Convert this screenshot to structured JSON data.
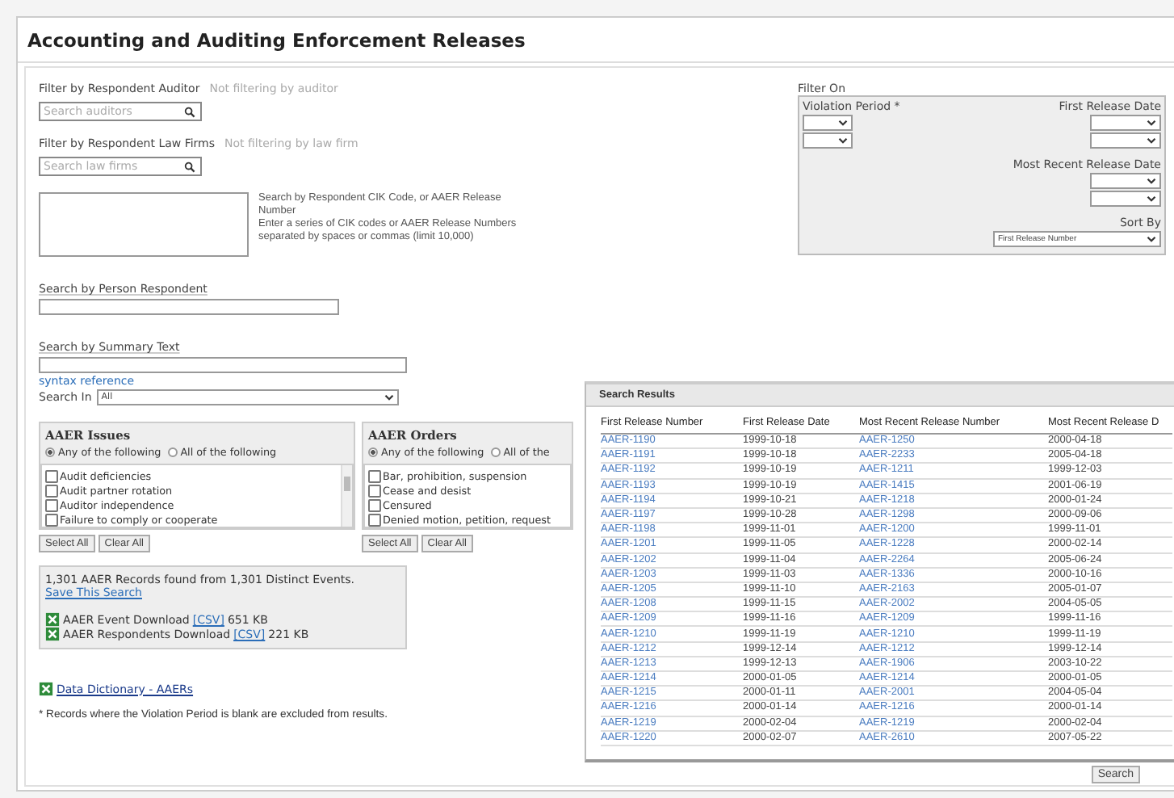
{
  "title": "Accounting and Auditing Enforcement Releases",
  "auditor_filter": {
    "label": "Filter by Respondent Auditor",
    "status": "Not filtering by auditor",
    "placeholder": "Search auditors"
  },
  "law_firm_filter": {
    "label": "Filter by Respondent Law Firms",
    "status": "Not filtering by law firm",
    "placeholder": "Search law firms"
  },
  "cik_search": {
    "help": [
      "Search by Respondent CIK Code, or AAER Release Number",
      "Enter a series of CIK codes or AAER Release Numbers separated by spaces or commas (limit 10,000)"
    ]
  },
  "person_search": {
    "label": "Search by Person Respondent"
  },
  "summary_search": {
    "label": "Search by Summary Text",
    "link": "syntax reference"
  },
  "search_in": {
    "label": "Search In",
    "value": "All"
  },
  "groups": [
    {
      "title": "AAER Issues",
      "options": [
        {
          "label": "Any of the following",
          "selected": true
        },
        {
          "label": "All of the following",
          "selected": false
        }
      ],
      "items": [
        {
          "label": "Audit deficiencies",
          "checked": false
        },
        {
          "label": "Audit partner rotation",
          "checked": false
        },
        {
          "label": "Auditor independence",
          "checked": false
        },
        {
          "label": "Failure to comply or cooperate",
          "checked": false
        }
      ],
      "buttons": [
        "Select All",
        "Clear All"
      ]
    },
    {
      "title": "AAER Orders",
      "options": [
        {
          "label": "Any of the following",
          "selected": true
        },
        {
          "label": "All of the",
          "selected": false
        }
      ],
      "items": [
        {
          "label": "Bar, prohibition, suspension",
          "checked": false
        },
        {
          "label": "Cease and desist",
          "checked": false
        },
        {
          "label": "Censured",
          "checked": false
        },
        {
          "label": "Denied motion, petition, request",
          "checked": false
        }
      ],
      "buttons": [
        "Select All",
        "Clear All"
      ]
    }
  ],
  "results_summary": {
    "text": "1,301 AAER Records found from 1,301 Distinct Events.",
    "link": "Save This Search",
    "downloads": [
      {
        "label": "AAER Event Download",
        "link": "[CSV]",
        "size": "651 KB"
      },
      {
        "label": "AAER Respondents Download",
        "link": "[CSV]",
        "size": "221 KB"
      }
    ]
  },
  "data_dictionary": "Data Dictionary - AAERs",
  "footnote": "* Records where the Violation Period is blank are excluded from results.",
  "filter_on": {
    "title": "Filter On",
    "violation_period": "Violation Period *",
    "first_release_date": "First Release Date",
    "most_recent_release_date": "Most Recent Release Date",
    "sort_by": {
      "label": "Sort By",
      "value": "First Release Number"
    }
  },
  "search_results": {
    "title": "Search Results",
    "columns": [
      {
        "label": "First Release Number",
        "kind": "link"
      },
      {
        "label": "First Release Date",
        "kind": "text"
      },
      {
        "label": "Most Recent Release Number",
        "kind": "link"
      },
      {
        "label": "Most Recent Release D",
        "kind": "text"
      }
    ],
    "rows": [
      [
        "AAER-1190",
        "1999-10-18",
        "AAER-1250",
        "2000-04-18"
      ],
      [
        "AAER-1191",
        "1999-10-18",
        "AAER-2233",
        "2005-04-18"
      ],
      [
        "AAER-1192",
        "1999-10-19",
        "AAER-1211",
        "1999-12-03"
      ],
      [
        "AAER-1193",
        "1999-10-19",
        "AAER-1415",
        "2001-06-19"
      ],
      [
        "AAER-1194",
        "1999-10-21",
        "AAER-1218",
        "2000-01-24"
      ],
      [
        "AAER-1197",
        "1999-10-28",
        "AAER-1298",
        "2000-09-06"
      ],
      [
        "AAER-1198",
        "1999-11-01",
        "AAER-1200",
        "1999-11-01"
      ],
      [
        "AAER-1201",
        "1999-11-05",
        "AAER-1228",
        "2000-02-14"
      ],
      [
        "AAER-1202",
        "1999-11-04",
        "AAER-2264",
        "2005-06-24"
      ],
      [
        "AAER-1203",
        "1999-11-03",
        "AAER-1336",
        "2000-10-16"
      ],
      [
        "AAER-1205",
        "1999-11-10",
        "AAER-2163",
        "2005-01-07"
      ],
      [
        "AAER-1208",
        "1999-11-15",
        "AAER-2002",
        "2004-05-05"
      ],
      [
        "AAER-1209",
        "1999-11-16",
        "AAER-1209",
        "1999-11-16"
      ],
      [
        "AAER-1210",
        "1999-11-19",
        "AAER-1210",
        "1999-11-19"
      ],
      [
        "AAER-1212",
        "1999-12-14",
        "AAER-1212",
        "1999-12-14"
      ],
      [
        "AAER-1213",
        "1999-12-13",
        "AAER-1906",
        "2003-10-22"
      ],
      [
        "AAER-1214",
        "2000-01-05",
        "AAER-1214",
        "2000-01-05"
      ],
      [
        "AAER-1215",
        "2000-01-11",
        "AAER-2001",
        "2004-05-04"
      ],
      [
        "AAER-1216",
        "2000-01-14",
        "AAER-1216",
        "2000-01-14"
      ],
      [
        "AAER-1219",
        "2000-02-04",
        "AAER-1219",
        "2000-02-04"
      ],
      [
        "AAER-1220",
        "2000-02-07",
        "AAER-2610",
        "2007-05-22"
      ]
    ]
  },
  "search_button": "Search"
}
